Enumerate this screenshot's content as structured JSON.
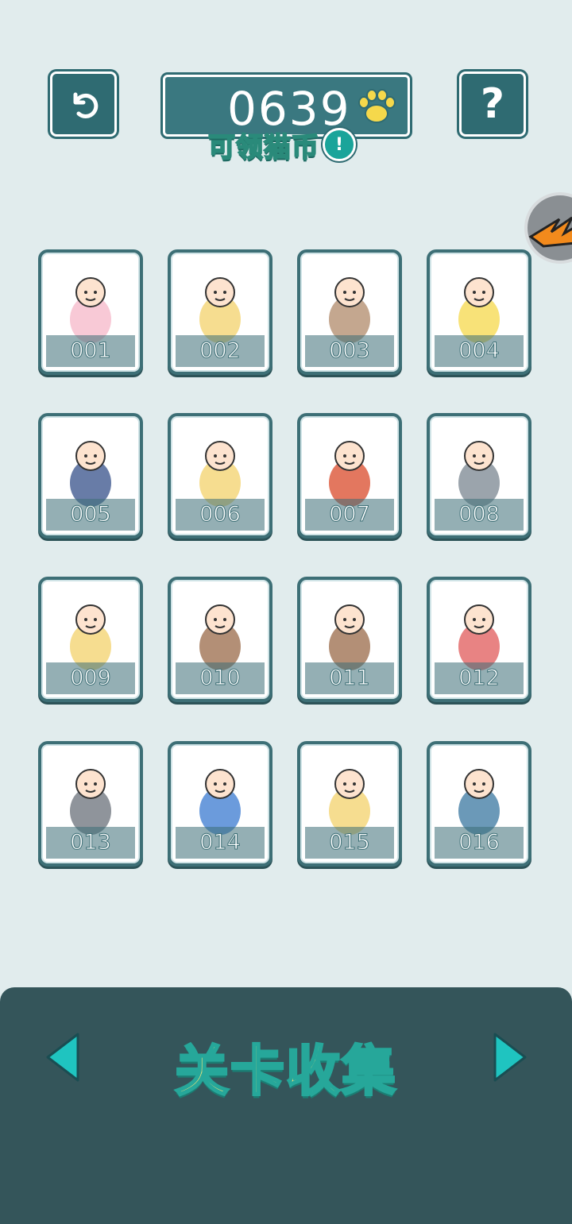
{
  "header": {
    "coin_count": "0639",
    "claim_label": "可领猫币",
    "claim_info_glyph": "!",
    "help_label": "?"
  },
  "levels": [
    {
      "number": "001",
      "art": "girl-icon"
    },
    {
      "number": "002",
      "art": "angry-boy-icon"
    },
    {
      "number": "003",
      "art": "tree-stump-icon"
    },
    {
      "number": "004",
      "art": "duck-float-cat-icon"
    },
    {
      "number": "005",
      "art": "police-icon"
    },
    {
      "number": "006",
      "art": "cat-ears-boy-icon"
    },
    {
      "number": "007",
      "art": "firefighter-icon"
    },
    {
      "number": "008",
      "art": "raccoon-icon"
    },
    {
      "number": "009",
      "art": "sleeping-girl-icon"
    },
    {
      "number": "010",
      "art": "bear-icon"
    },
    {
      "number": "011",
      "art": "bear-flower-icon"
    },
    {
      "number": "012",
      "art": "balloon-cat-icon"
    },
    {
      "number": "013",
      "art": "falling-cat-icon"
    },
    {
      "number": "014",
      "art": "cap-boy-icon"
    },
    {
      "number": "015",
      "art": "singing-boy-icon"
    },
    {
      "number": "016",
      "art": "subway-car-icon"
    }
  ],
  "footer": {
    "title": "关卡收集"
  },
  "colors": {
    "background": "#e1eced",
    "panel": "#3a7880",
    "footer": "#34555a",
    "accent": "#1fc4c0",
    "title_yellow": "#f3e27a"
  }
}
